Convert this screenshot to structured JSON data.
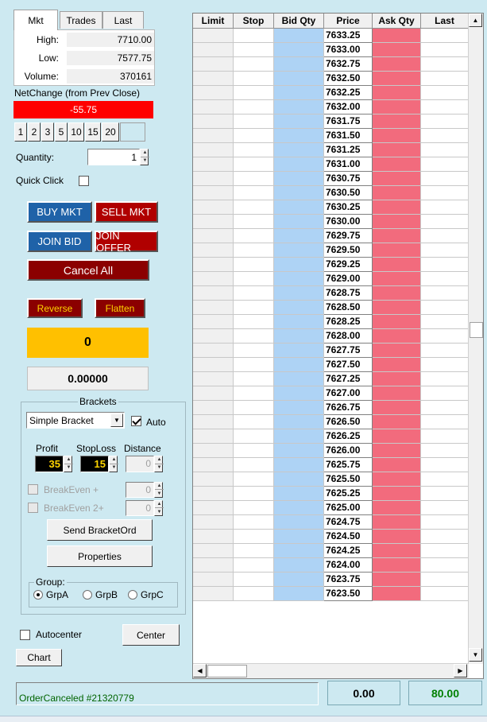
{
  "tabs": [
    {
      "label": "Mkt",
      "active": true
    },
    {
      "label": "Trades",
      "active": false
    },
    {
      "label": "Last",
      "active": false
    }
  ],
  "stats": {
    "high_label": "High:",
    "high_value": "7710.00",
    "low_label": "Low:",
    "low_value": "7577.75",
    "volume_label": "Volume:",
    "volume_value": "370161"
  },
  "net_change": {
    "label": "NetChange (from Prev Close)",
    "value": "-55.75",
    "color": "#ff0000"
  },
  "quantity_presets": [
    "1",
    "2",
    "3",
    "5",
    "10",
    "15",
    "20"
  ],
  "quantity": {
    "label": "Quantity:",
    "value": "1"
  },
  "quick_click": {
    "label": "Quick Click",
    "checked": false
  },
  "buttons": {
    "buy_mkt": "BUY MKT",
    "sell_mkt": "SELL MKT",
    "join_bid": "JOIN BID",
    "join_offer": "JOIN OFFER",
    "cancel_all": "Cancel All",
    "reverse": "Reverse",
    "flatten": "Flatten"
  },
  "position": {
    "value": "0",
    "color": "#ffc000"
  },
  "pnl": {
    "value": "0.00000"
  },
  "brackets": {
    "title": "Brackets",
    "type_value": "Simple Bracket",
    "auto_label": "Auto",
    "auto_checked": true,
    "profit_label": "Profit",
    "profit_value": "35",
    "stoploss_label": "StopLoss",
    "stoploss_value": "15",
    "distance_label": "Distance",
    "distance_value": "0",
    "breakeven1_label": "BreakEven +",
    "breakeven1_value": "0",
    "breakeven2_label": "BreakEven 2+",
    "breakeven2_value": "0",
    "send_label": "Send BracketOrd",
    "properties_label": "Properties",
    "group_label": "Group:",
    "groups": [
      {
        "label": "GrpA",
        "checked": true
      },
      {
        "label": "GrpB",
        "checked": false
      },
      {
        "label": "GrpC",
        "checked": false
      }
    ]
  },
  "autocenter": {
    "label": "Autocenter",
    "checked": false
  },
  "center_button": "Center",
  "chart_button": "Chart",
  "ladder": {
    "columns": [
      "Limit",
      "Stop",
      "Bid Qty",
      "Price",
      "Ask Qty",
      "Last"
    ],
    "prices": [
      "7633.25",
      "7633.00",
      "7632.75",
      "7632.50",
      "7632.25",
      "7632.00",
      "7631.75",
      "7631.50",
      "7631.25",
      "7631.00",
      "7630.75",
      "7630.50",
      "7630.25",
      "7630.00",
      "7629.75",
      "7629.50",
      "7629.25",
      "7629.00",
      "7628.75",
      "7628.50",
      "7628.25",
      "7628.00",
      "7627.75",
      "7627.50",
      "7627.25",
      "7627.00",
      "7626.75",
      "7626.50",
      "7626.25",
      "7626.00",
      "7625.75",
      "7625.50",
      "7625.25",
      "7625.00",
      "7624.75",
      "7624.50",
      "7624.25",
      "7624.00",
      "7623.75",
      "7623.50"
    ],
    "colors": {
      "bid": "#aed3f5",
      "ask": "#f26b7d"
    }
  },
  "status_bar": {
    "message": "OrderCanceled #21320779",
    "message_color": "#006400",
    "value1": "0.00",
    "value2": "80.00",
    "value2_color": "#008000"
  }
}
